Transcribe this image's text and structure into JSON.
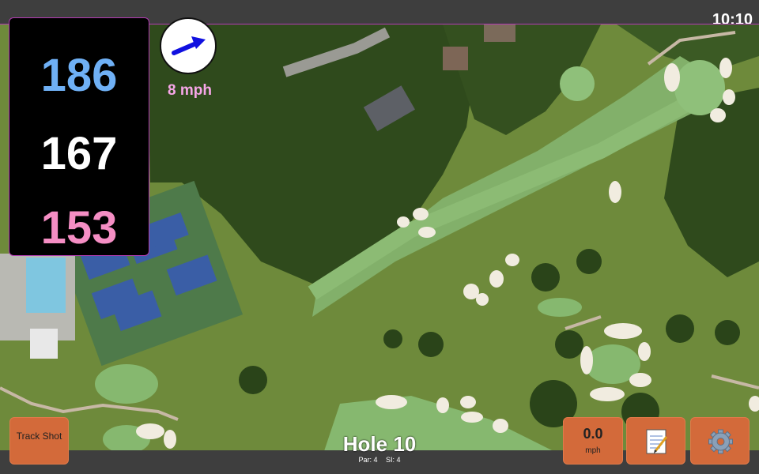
{
  "status": {
    "time": "10:10"
  },
  "yardages": {
    "back": "186",
    "middle": "167",
    "front": "153"
  },
  "wind": {
    "speed_label": "8 mph",
    "icon": "wind-arrow-icon"
  },
  "buttons": {
    "track_shot_label": "Track Shot",
    "speed_value": "0.0",
    "speed_unit": "mph",
    "notes_icon": "notepad-icon",
    "settings_icon": "gear-icon"
  },
  "hole": {
    "title": "Hole 10",
    "par": "Par: 4",
    "si": "SI: 4"
  },
  "colors": {
    "accent_border": "#b23bb2",
    "button": "#d36a3a",
    "back": "#6fb0f5",
    "front": "#f58ec4"
  }
}
